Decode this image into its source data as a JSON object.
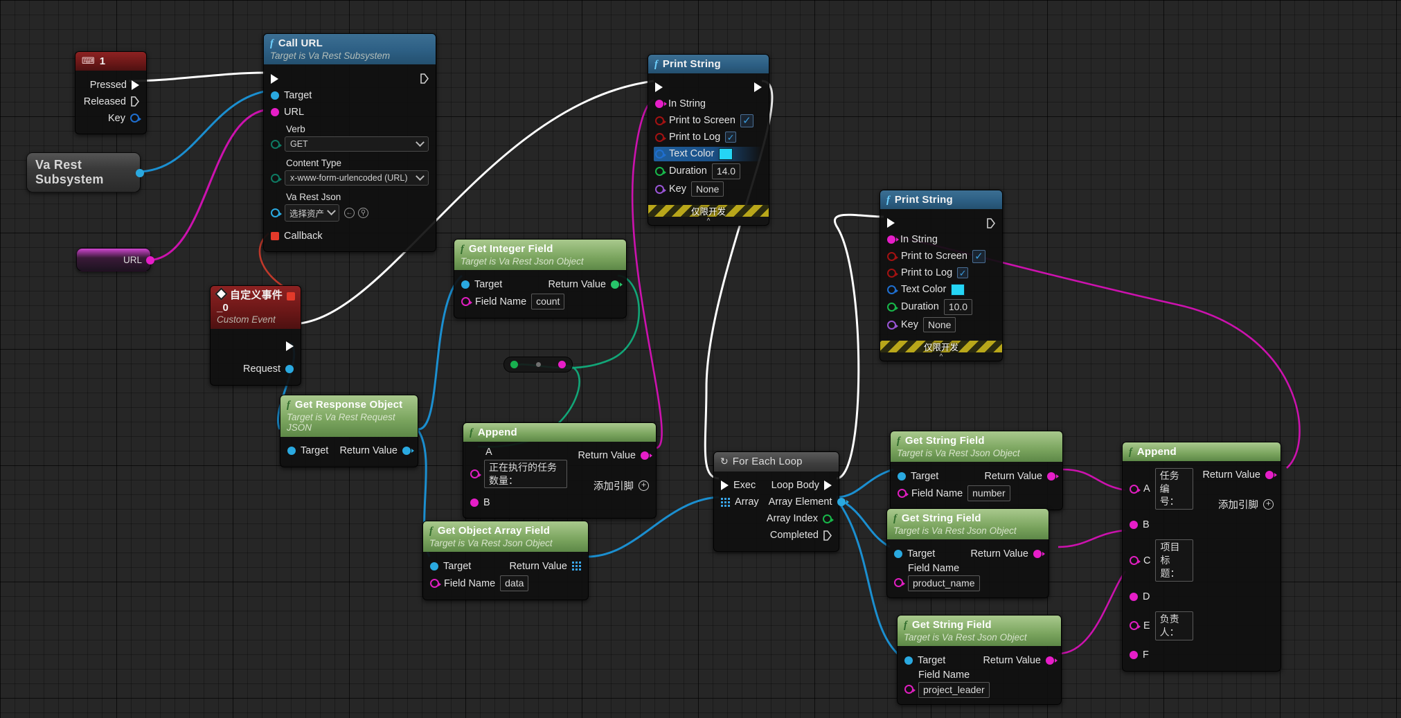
{
  "app": {
    "name": "Unreal Engine Blueprint Event Graph",
    "canvas_background": "#262626"
  },
  "colors": {
    "exec_white": "#ffffff",
    "object_cyan": "#2aa9e0",
    "string_magenta": "#e61ec8",
    "int_green": "#18b84a",
    "bool_red": "#a31212",
    "struct_blue": "#1f6fd0",
    "text_color_swatch": "#25d5f5"
  },
  "nodes": {
    "key_event": {
      "title": "1",
      "icon": "keyboard-icon",
      "pins": [
        {
          "label": "Pressed",
          "type": "exec-out"
        },
        {
          "label": "Released",
          "type": "exec-out"
        },
        {
          "label": "Key",
          "type": "data-out"
        }
      ]
    },
    "va_rest_subsystem": {
      "label_line1": "Va Rest",
      "label_line2": "Subsystem"
    },
    "url_variable": {
      "label": "URL"
    },
    "call_url": {
      "title": "Call URL",
      "subtitle": "Target is Va Rest Subsystem",
      "inputs": [
        {
          "label": "Target",
          "type": "object"
        },
        {
          "label": "URL",
          "type": "string"
        }
      ],
      "properties": [
        {
          "label": "Verb",
          "value": "GET"
        },
        {
          "label": "Content Type",
          "value": "x-www-form-urlencoded (URL)"
        },
        {
          "label": "Va Rest Json",
          "value": "选择资产"
        }
      ],
      "callback_label": "Callback"
    },
    "custom_event": {
      "title": "自定义事件_0",
      "subtitle": "Custom Event",
      "outputs": [
        {
          "label": "Request",
          "type": "object"
        }
      ]
    },
    "get_response_object": {
      "title": "Get Response Object",
      "subtitle": "Target is Va Rest Request JSON",
      "input_label": "Target",
      "output_label": "Return Value"
    },
    "get_integer_field": {
      "title": "Get Integer Field",
      "subtitle": "Target is Va Rest Json Object",
      "input_label": "Target",
      "output_label": "Return Value",
      "field_name_label": "Field Name",
      "field_name_value": "count"
    },
    "get_object_array_field": {
      "title": "Get Object Array Field",
      "subtitle": "Target is Va Rest Json Object",
      "input_label": "Target",
      "output_label": "Return Value",
      "field_name_label": "Field Name",
      "field_name_value": "data"
    },
    "append_1": {
      "title": "Append",
      "pin_a_label": "A",
      "pin_a_value": "正在执行的任务数量：",
      "pin_b_label": "B",
      "output_label": "Return Value",
      "add_pin_label": "添加引脚"
    },
    "append_2": {
      "title": "Append",
      "output_label": "Return Value",
      "add_pin_label": "添加引脚",
      "pins": [
        {
          "label": "A",
          "value": "任务编号："
        },
        {
          "label": "B",
          "value": ""
        },
        {
          "label": "C",
          "value": "项目标题："
        },
        {
          "label": "D",
          "value": ""
        },
        {
          "label": "E",
          "value": "负责人："
        },
        {
          "label": "F",
          "value": ""
        }
      ]
    },
    "print_string_1": {
      "title": "Print String",
      "in_string_label": "In String",
      "print_to_screen_label": "Print to Screen",
      "print_to_screen_checked": true,
      "print_to_log_label": "Print to Log",
      "print_to_log_checked": true,
      "text_color_label": "Text Color",
      "duration_label": "Duration",
      "duration_value": "14.0",
      "key_label": "Key",
      "key_value": "None",
      "dev_only_label": "仅限开发"
    },
    "print_string_2": {
      "title": "Print String",
      "in_string_label": "In String",
      "print_to_screen_label": "Print to Screen",
      "print_to_screen_checked": true,
      "print_to_log_label": "Print to Log",
      "print_to_log_checked": true,
      "text_color_label": "Text Color",
      "duration_label": "Duration",
      "duration_value": "10.0",
      "key_label": "Key",
      "key_value": "None",
      "dev_only_label": "仅限开发"
    },
    "for_each_loop": {
      "title": "For Each Loop",
      "icon": "loop-icon",
      "inputs": [
        {
          "label": "Exec",
          "type": "exec"
        },
        {
          "label": "Array",
          "type": "array"
        }
      ],
      "outputs": [
        {
          "label": "Loop Body",
          "type": "exec"
        },
        {
          "label": "Array Element",
          "type": "object"
        },
        {
          "label": "Array Index",
          "type": "int"
        },
        {
          "label": "Completed",
          "type": "exec"
        }
      ]
    },
    "get_string_field_1": {
      "title": "Get String Field",
      "subtitle": "Target is Va Rest Json Object",
      "input_label": "Target",
      "output_label": "Return Value",
      "field_name_label": "Field Name",
      "field_name_value": "number"
    },
    "get_string_field_2": {
      "title": "Get String Field",
      "subtitle": "Target is Va Rest Json Object",
      "input_label": "Target",
      "output_label": "Return Value",
      "field_name_label": "Field Name",
      "field_name_value": "product_name"
    },
    "get_string_field_3": {
      "title": "Get String Field",
      "subtitle": "Target is Va Rest Json Object",
      "input_label": "Target",
      "output_label": "Return Value",
      "field_name_label": "Field Name",
      "field_name_value": "project_leader"
    }
  }
}
